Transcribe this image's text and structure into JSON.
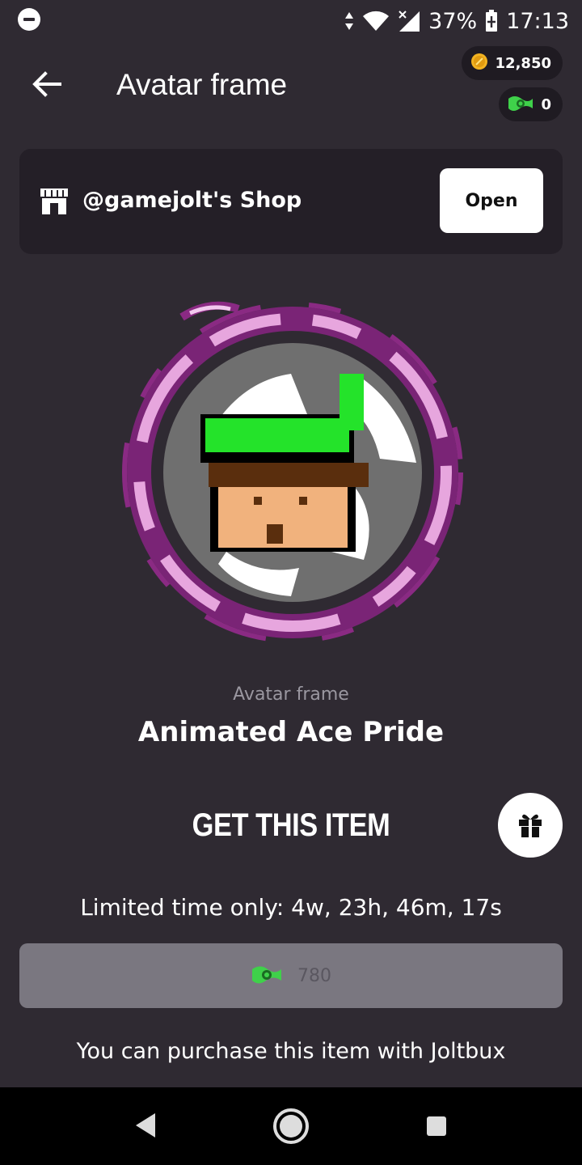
{
  "status_bar": {
    "battery": "37%",
    "time": "17:13",
    "icons": [
      "do-not-disturb-icon",
      "data-arrows-icon",
      "wifi-icon",
      "signal-icon",
      "battery-charging-icon"
    ]
  },
  "header": {
    "title": "Avatar frame",
    "coins": "12,850",
    "joltbux": "0"
  },
  "shop": {
    "name": "@gamejolt's Shop",
    "open_label": "Open"
  },
  "item": {
    "type": "Avatar frame",
    "name": "Animated Ace Pride"
  },
  "purchase": {
    "heading": "GET THIS ITEM",
    "limited_time": "Limited time only: 4w, 23h, 46m, 17s",
    "price": "780",
    "note": "You can purchase this item with Joltbux"
  },
  "colors": {
    "background": "#2f2a32",
    "card": "#241f27",
    "frame_purple": "#8a2a83",
    "frame_pink": "#e7a6de",
    "joltbux_green": "#3fd14a",
    "coin_gold": "#f2b321"
  }
}
